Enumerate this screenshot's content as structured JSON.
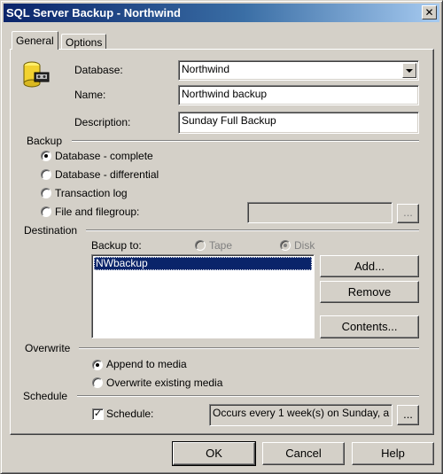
{
  "window": {
    "title": "SQL Server Backup - Northwind",
    "close_glyph": "✕"
  },
  "tabs": [
    {
      "label": "General",
      "active": true
    },
    {
      "label": "Options",
      "active": false
    }
  ],
  "general": {
    "icon": "database-backup-icon",
    "database_label": "Database:",
    "database_value": "Northwind",
    "name_label": "Name:",
    "name_value": "Northwind backup",
    "description_label": "Description:",
    "description_value": "Sunday Full Backup"
  },
  "backup": {
    "heading": "Backup",
    "options": [
      {
        "label": "Database - complete",
        "checked": true
      },
      {
        "label": "Database - differential",
        "checked": false
      },
      {
        "label": "Transaction log",
        "checked": false
      },
      {
        "label": "File and filegroup:",
        "checked": false
      }
    ],
    "filegroup_value": "",
    "browse_label": "..."
  },
  "destination": {
    "heading": "Destination",
    "backup_to_label": "Backup to:",
    "tape_label": "Tape",
    "disk_label": "Disk",
    "selected_media": "Disk",
    "items": [
      "NWbackup"
    ],
    "add_label": "Add...",
    "remove_label": "Remove",
    "contents_label": "Contents..."
  },
  "overwrite": {
    "heading": "Overwrite",
    "append_label": "Append to media",
    "overwrite_label": "Overwrite existing media",
    "selected": "append"
  },
  "schedule": {
    "heading": "Schedule",
    "checkbox_label": "Schedule:",
    "checked": true,
    "check_glyph": "✓",
    "value": "Occurs every 1 week(s) on Sunday, a",
    "browse_label": "..."
  },
  "footer": {
    "ok_label": "OK",
    "cancel_label": "Cancel",
    "help_label": "Help"
  }
}
